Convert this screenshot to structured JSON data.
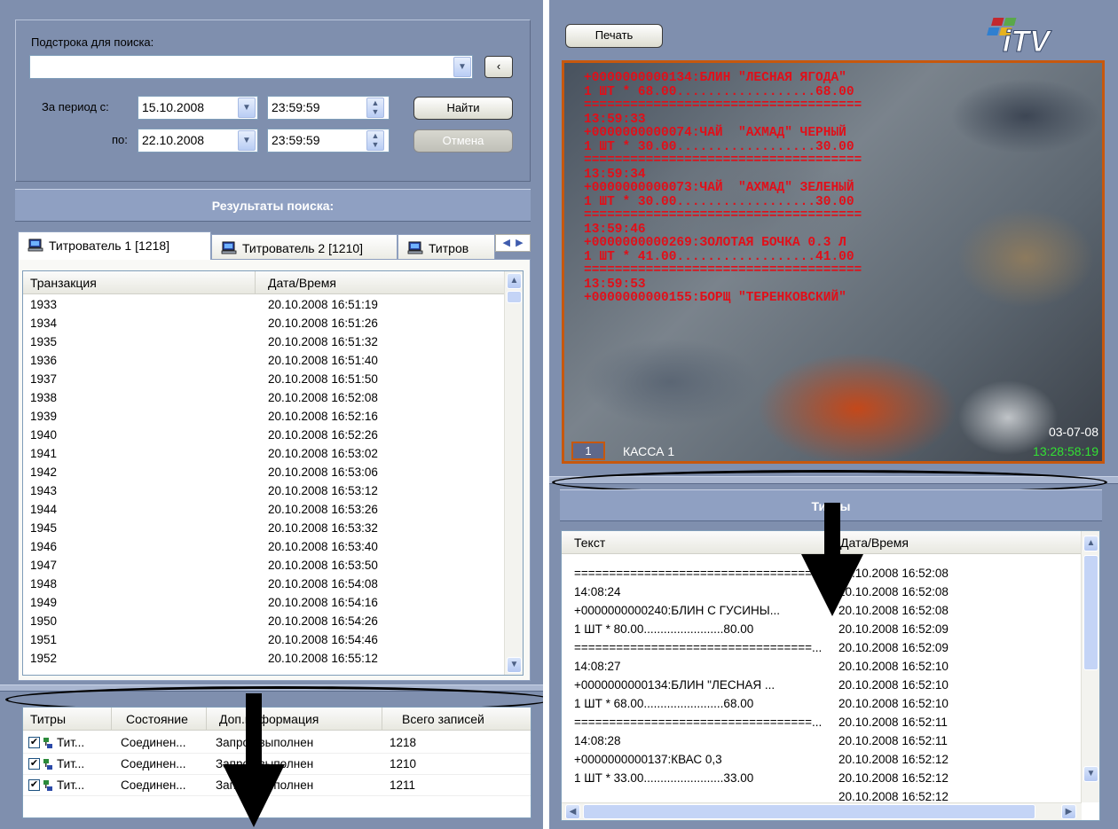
{
  "left": {
    "search_label": "Подстрока для поиска:",
    "search_value": "",
    "period_from_label": "За период с:",
    "period_to_label": "по:",
    "date_from": "15.10.2008",
    "time_from": "23:59:59",
    "date_to": "22.10.2008",
    "time_to": "23:59:59",
    "find_button": "Найти",
    "cancel_button": "Отмена",
    "results_header": "Результаты поиска:",
    "tabs": [
      {
        "label": "Титрователь 1 [1218]"
      },
      {
        "label": "Титрователь 2 [1210]"
      },
      {
        "label": "Титров"
      }
    ],
    "results_columns": [
      "Транзакция",
      "Дата/Время"
    ],
    "results_rows": [
      [
        "1933",
        "20.10.2008 16:51:19"
      ],
      [
        "1934",
        "20.10.2008 16:51:26"
      ],
      [
        "1935",
        "20.10.2008 16:51:32"
      ],
      [
        "1936",
        "20.10.2008 16:51:40"
      ],
      [
        "1937",
        "20.10.2008 16:51:50"
      ],
      [
        "1938",
        "20.10.2008 16:52:08"
      ],
      [
        "1939",
        "20.10.2008 16:52:16"
      ],
      [
        "1940",
        "20.10.2008 16:52:26"
      ],
      [
        "1941",
        "20.10.2008 16:53:02"
      ],
      [
        "1942",
        "20.10.2008 16:53:06"
      ],
      [
        "1943",
        "20.10.2008 16:53:12"
      ],
      [
        "1944",
        "20.10.2008 16:53:26"
      ],
      [
        "1945",
        "20.10.2008 16:53:32"
      ],
      [
        "1946",
        "20.10.2008 16:53:40"
      ],
      [
        "1947",
        "20.10.2008 16:53:50"
      ],
      [
        "1948",
        "20.10.2008 16:54:08"
      ],
      [
        "1949",
        "20.10.2008 16:54:16"
      ],
      [
        "1950",
        "20.10.2008 16:54:26"
      ],
      [
        "1951",
        "20.10.2008 16:54:46"
      ],
      [
        "1952",
        "20.10.2008 16:55:12"
      ]
    ],
    "status_columns": [
      "Титры",
      "Состояние",
      "Доп.информация",
      "Всего записей"
    ],
    "status_rows": [
      [
        "Тит...",
        "Соединен...",
        "Запрос выполнен",
        "1218"
      ],
      [
        "Тит...",
        "Соединен...",
        "Запрос выполнен",
        "1210"
      ],
      [
        "Тит...",
        "Соединен...",
        "Запрос выполнен",
        "1211"
      ]
    ]
  },
  "right": {
    "print_button": "Печать",
    "logo_text": "iTV",
    "osd_lines": [
      "+0000000000134:БЛИН \"ЛЕСНАЯ ЯГОДА\"",
      "1 ШТ * 68.00..................68.00",
      "====================================",
      "13:59:33",
      "+0000000000074:ЧАЙ  \"АХМАД\" ЧЕРНЫЙ",
      "1 ШТ * 30.00..................30.00",
      "====================================",
      "13:59:34",
      "+0000000000073:ЧАЙ  \"АХМАД\" ЗЕЛЕНЫЙ",
      "1 ШТ * 30.00..................30.00",
      "====================================",
      "13:59:46",
      "+0000000000269:ЗОЛОТАЯ БОЧКА 0.3 Л",
      "1 ШТ * 41.00..................41.00",
      "====================================",
      "13:59:53",
      "+0000000000155:БОРЩ \"ТЕРЕНКОВСКИЙ\""
    ],
    "camera_number": "1",
    "camera_name": "КАССА 1",
    "video_date": "03-07-08",
    "video_time": "13:28:58:19",
    "titles_header": "Титры",
    "titles_columns": [
      "Текст",
      "Дата/Время"
    ],
    "titles_rows": [
      [
        "====================================",
        "20.10.2008 16:52:08"
      ],
      [
        "14:08:24",
        "20.10.2008 16:52:08"
      ],
      [
        "+0000000000240:БЛИН С ГУСИНЫ...",
        "20.10.2008 16:52:08"
      ],
      [
        "1 ШТ * 80.00........................80.00",
        "20.10.2008 16:52:09"
      ],
      [
        "==================================...",
        "20.10.2008 16:52:09"
      ],
      [
        "14:08:27",
        "20.10.2008 16:52:10"
      ],
      [
        "+0000000000134:БЛИН \"ЛЕСНАЯ ...",
        "20.10.2008 16:52:10"
      ],
      [
        "1 ШТ * 68.00........................68.00",
        "20.10.2008 16:52:10"
      ],
      [
        "==================================...",
        "20.10.2008 16:52:11"
      ],
      [
        "14:08:28",
        "20.10.2008 16:52:11"
      ],
      [
        "+0000000000137:КВАС 0,3",
        "20.10.2008 16:52:12"
      ],
      [
        "1 ШТ * 33.00........................33.00",
        "20.10.2008 16:52:12"
      ],
      [
        "",
        "20.10.2008 16:52:12"
      ]
    ]
  }
}
